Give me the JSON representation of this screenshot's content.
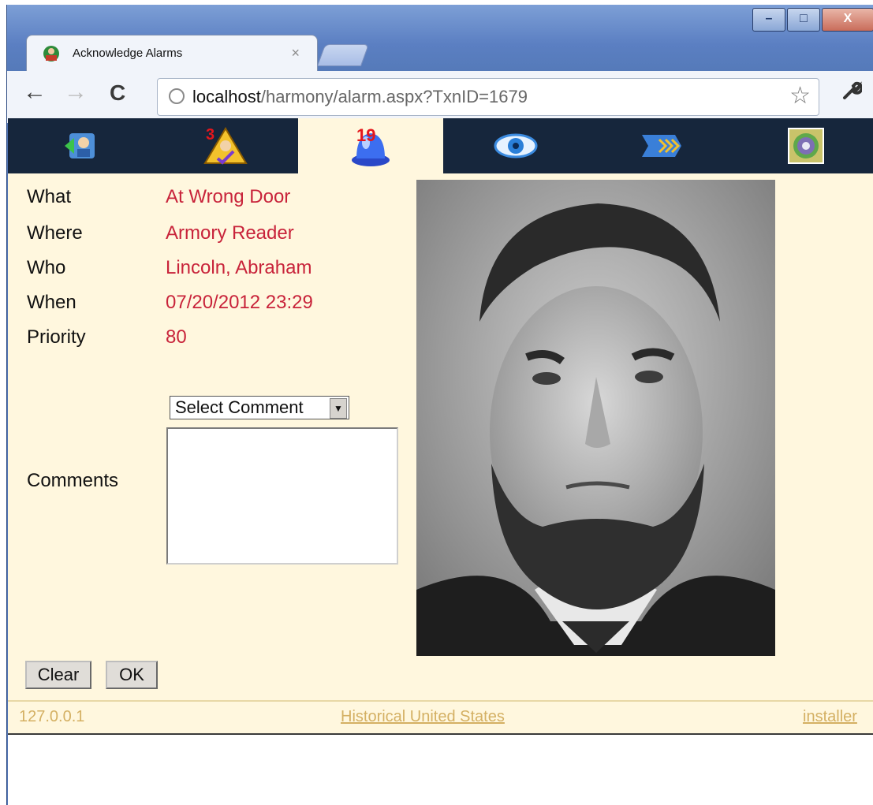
{
  "browser": {
    "tab_title": "Acknowledge Alarms",
    "tab_close": "×",
    "url_host": "localhost",
    "url_path": "/harmony/alarm.aspx?TxnID=1679",
    "window_buttons": [
      "–",
      "□",
      "X"
    ],
    "nav": {
      "back": "←",
      "forward": "→",
      "reload": "C",
      "star": "☆",
      "wrench": "🔧"
    }
  },
  "iconbar": {
    "badges": {
      "user_check": "3",
      "alarm": "19"
    },
    "items": [
      "back-to-list",
      "user-check",
      "alarm",
      "view",
      "forward",
      "camera"
    ]
  },
  "alarm": {
    "labels": {
      "what": "What",
      "where": "Where",
      "who": "Who",
      "when": "When",
      "priority": "Priority",
      "comments": "Comments"
    },
    "values": {
      "what": "At Wrong Door",
      "where": "Armory Reader",
      "who": "Lincoln, Abraham",
      "when": "07/20/2012 23:29",
      "priority": "80"
    },
    "comment_select": "Select Comment",
    "comment_text": ""
  },
  "buttons": {
    "clear": "Clear",
    "ok": "OK"
  },
  "footer": {
    "ip": "127.0.0.1",
    "site": "Historical United States",
    "user": "installer"
  },
  "colors": {
    "navbar": "#16263c",
    "content_bg": "#fff7de",
    "value_text": "#c8233a",
    "footer_text": "#d4b063"
  }
}
